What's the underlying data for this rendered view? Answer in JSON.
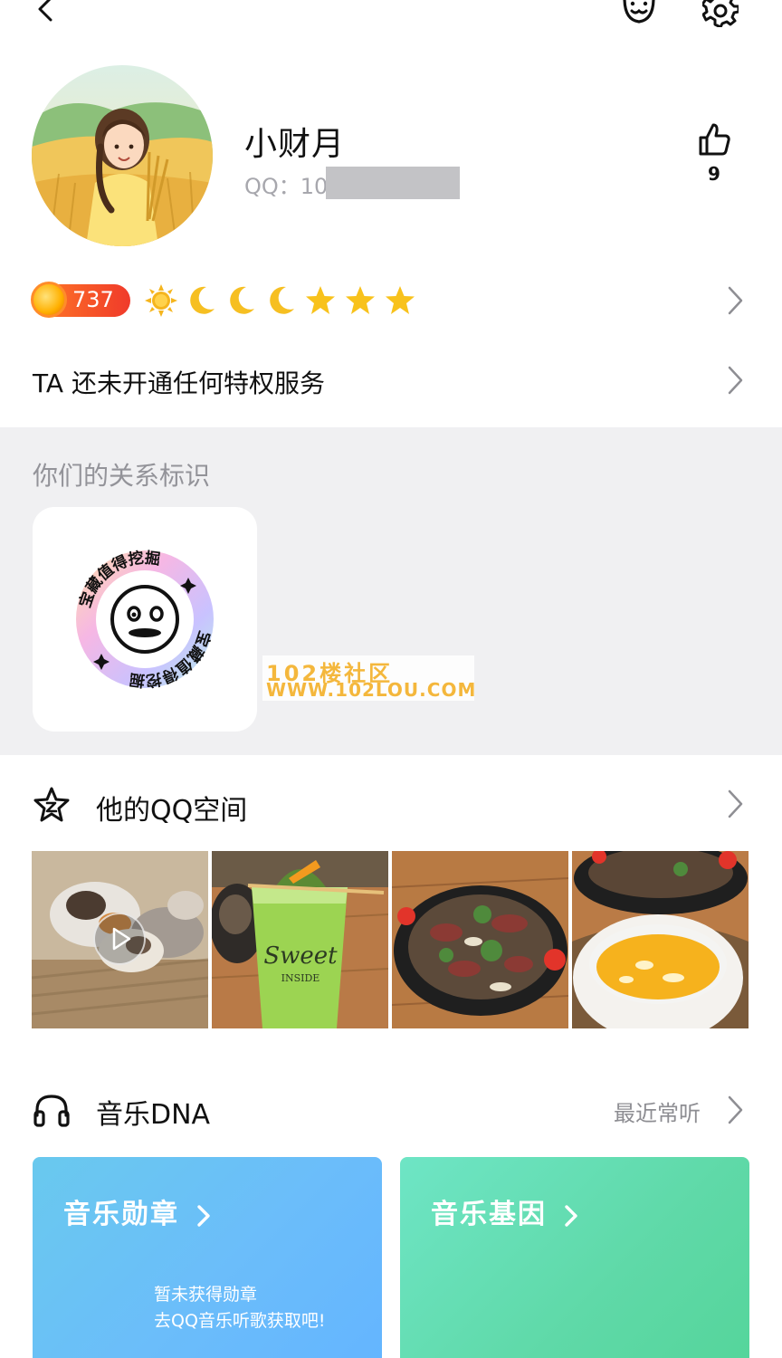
{
  "header": {
    "back_icon": "chevron-left-icon",
    "friend_icon": "add-friend-icon",
    "settings_icon": "gear-icon"
  },
  "profile": {
    "nickname": "小财月",
    "qq_label": "QQ：10",
    "like_count": "9"
  },
  "level": {
    "value": "737",
    "icons": [
      "sun",
      "moon",
      "moon",
      "moon",
      "star",
      "star",
      "star"
    ]
  },
  "privilege": {
    "text": "TA 还未开通任何特权服务"
  },
  "relationship": {
    "title": "你们的关系标识",
    "badge_text": "宝藏值得挖掘"
  },
  "watermark": {
    "line1": "102楼社区",
    "line2": "WWW.102LOU.COM"
  },
  "qzone": {
    "title": "他的QQ空间",
    "photos": [
      "kittens-video",
      "green-drink",
      "beef-salad",
      "soup-and-skillet"
    ],
    "drink_cup_text1": "Sweet",
    "drink_cup_text2": "INSIDE"
  },
  "music": {
    "title": "音乐DNA",
    "recent_label": "最近常听",
    "medal_title": "音乐勋章",
    "medal_desc_1": "暂未获得勋章",
    "medal_desc_2": "去QQ音乐听歌获取吧!",
    "gene_title": "音乐基因"
  },
  "colors": {
    "section_bg": "#f0f0f2",
    "level_badge": "#f05a2a",
    "star_gold": "#f8c21c",
    "medal_card": "#6bbdfa",
    "gene_card": "#5fd9a8"
  }
}
